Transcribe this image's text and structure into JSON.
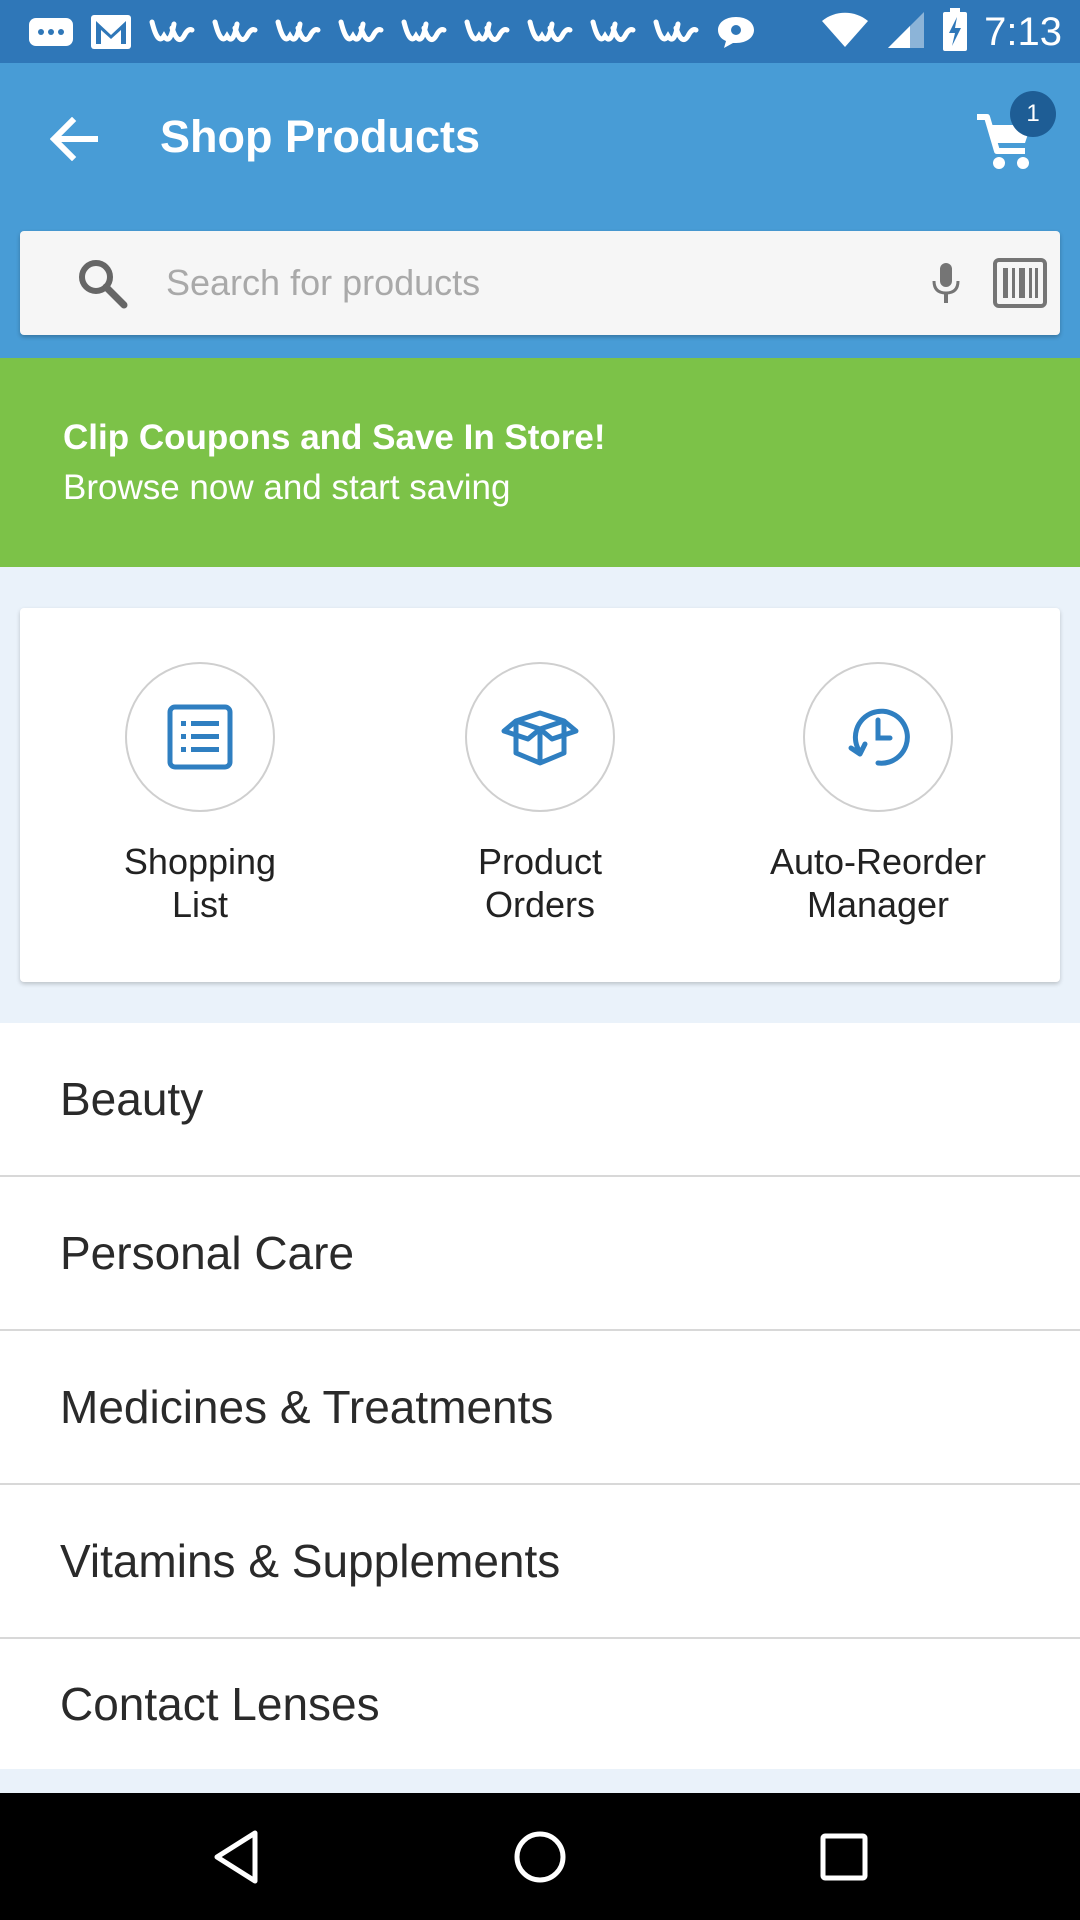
{
  "status_bar": {
    "time": "7:13",
    "left_icons": [
      "message-icon",
      "gmail-icon",
      "walgreens-icon",
      "walgreens-icon",
      "walgreens-icon",
      "walgreens-icon",
      "walgreens-icon",
      "walgreens-icon",
      "walgreens-icon",
      "walgreens-icon",
      "walgreens-icon",
      "chat-icon"
    ],
    "right_icons": [
      "wifi-icon",
      "cell-signal-icon",
      "battery-charging-icon"
    ]
  },
  "app_bar": {
    "title": "Shop Products",
    "cart_count": "1",
    "color": "#489cd6"
  },
  "search": {
    "placeholder": "Search for products",
    "value": ""
  },
  "promo": {
    "title": "Clip Coupons and Save In Store!",
    "subtitle": "Browse now and start saving",
    "color": "#7cc248"
  },
  "quick_links": [
    {
      "line1": "Shopping",
      "line2": "List",
      "icon": "list-icon"
    },
    {
      "line1": "Product",
      "line2": "Orders",
      "icon": "box-icon"
    },
    {
      "line1": "Auto-Reorder",
      "line2": "Manager",
      "icon": "clock-icon"
    }
  ],
  "categories": [
    "Beauty",
    "Personal Care",
    "Medicines & Treatments",
    "Vitamins & Supplements",
    "Contact Lenses"
  ],
  "accent_color": "#2f7fc1"
}
